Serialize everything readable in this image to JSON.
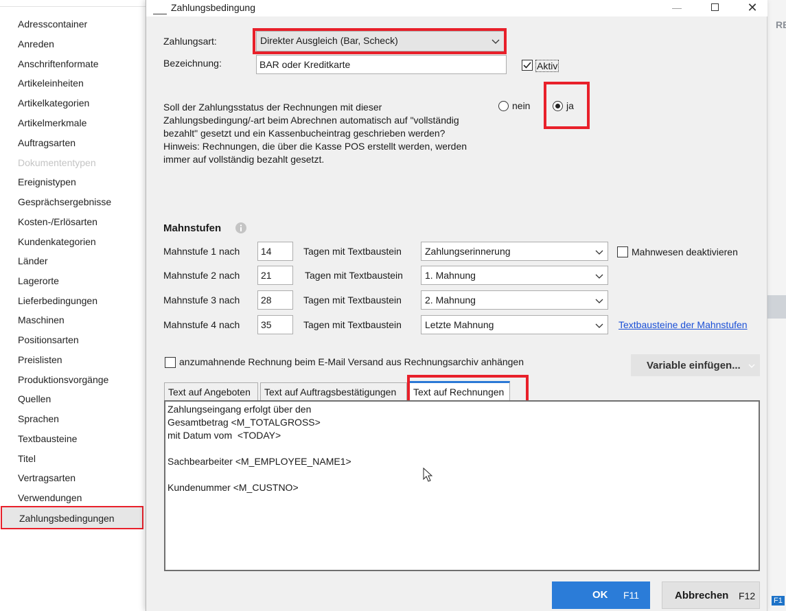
{
  "sidebar": {
    "items": [
      {
        "label": "Adresscontainer"
      },
      {
        "label": "Anreden"
      },
      {
        "label": "Anschriftenformate"
      },
      {
        "label": "Artikeleinheiten"
      },
      {
        "label": "Artikelkategorien"
      },
      {
        "label": "Artikelmerkmale"
      },
      {
        "label": "Auftragsarten"
      },
      {
        "label": "Dokumententypen",
        "disabled": true
      },
      {
        "label": "Ereignistypen"
      },
      {
        "label": "Gesprächsergebnisse"
      },
      {
        "label": "Kosten-/Erlösarten"
      },
      {
        "label": "Kundenkategorien"
      },
      {
        "label": "Länder"
      },
      {
        "label": "Lagerorte"
      },
      {
        "label": "Lieferbedingungen"
      },
      {
        "label": "Maschinen"
      },
      {
        "label": "Positionsarten"
      },
      {
        "label": "Preislisten"
      },
      {
        "label": "Produktionsvorgänge"
      },
      {
        "label": "Quellen"
      },
      {
        "label": "Sprachen"
      },
      {
        "label": "Textbausteine"
      },
      {
        "label": "Titel"
      },
      {
        "label": "Vertragsarten"
      },
      {
        "label": "Verwendungen"
      },
      {
        "label": "Zahlungsbedingungen",
        "selected": true
      }
    ]
  },
  "background": {
    "right_fragment": "RE",
    "right_fragment2": "F1"
  },
  "dialog": {
    "title": "Zahlungsbedingung",
    "window_controls": {
      "minimize": "—",
      "close": "✕"
    },
    "zahlungsart": {
      "label": "Zahlungsart:",
      "value": "Direkter Ausgleich (Bar, Scheck)"
    },
    "bezeichnung": {
      "label": "Bezeichnung:",
      "value": "BAR oder Kreditkarte"
    },
    "aktiv": {
      "label": "Aktiv",
      "checked": true
    },
    "question": {
      "lines": [
        "Soll der Zahlungsstatus der Rechnungen mit dieser",
        "Zahlungsbedingung/-art beim Abrechnen automatisch auf \"vollständig",
        "bezahlt\" gesetzt und ein Kassenbucheintrag geschrieben werden?",
        "Hinweis: Rechnungen, die über die Kasse POS erstellt werden, werden",
        "immer auf vollständig bezahlt gesetzt."
      ],
      "options": [
        {
          "label": "nein",
          "selected": false
        },
        {
          "label": "ja",
          "selected": true
        }
      ]
    },
    "mahnstufen": {
      "heading": "Mahnstufen",
      "info_icon": "info-icon",
      "days_label": "Tagen mit Textbaustein",
      "rows": [
        {
          "label": "Mahnstufe 1 nach",
          "days": "14",
          "template": "Zahlungserinnerung"
        },
        {
          "label": "Mahnstufe 2 nach",
          "days": "21",
          "template": "1. Mahnung"
        },
        {
          "label": "Mahnstufe 3 nach",
          "days": "28",
          "template": "2. Mahnung"
        },
        {
          "label": "Mahnstufe 4 nach",
          "days": "35",
          "template": "Letzte Mahnung"
        }
      ],
      "deactivate_label": "Mahnwesen deaktivieren",
      "deactivate_checked": false,
      "link": "Textbausteine der Mahnstufen"
    },
    "attach": {
      "label": "anzumahnende Rechnung beim E-Mail Versand aus Rechnungsarchiv anhängen",
      "checked": false
    },
    "variable_button": "Variable einfügen...",
    "tabs": [
      {
        "label": "Text auf Angeboten",
        "active": false
      },
      {
        "label": "Text auf Auftragsbestätigungen",
        "active": false
      },
      {
        "label": "Text auf Rechnungen",
        "active": true
      }
    ],
    "text_lines": [
      "Zahlungseingang erfolgt über den",
      "Gesamtbetrag <M_TOTALGROSS>",
      "mit Datum vom  <TODAY>",
      "",
      "Sachbearbeiter <M_EMPLOYEE_NAME1>",
      "",
      "Kundenummer <M_CUSTNO>"
    ],
    "ok": {
      "label": "OK",
      "key": "F11"
    },
    "cancel": {
      "label": "Abbrechen",
      "key": "F12"
    }
  },
  "colors": {
    "highlight": "#e8202a",
    "primary": "#2b7cd8",
    "link": "#1a4fd6"
  }
}
